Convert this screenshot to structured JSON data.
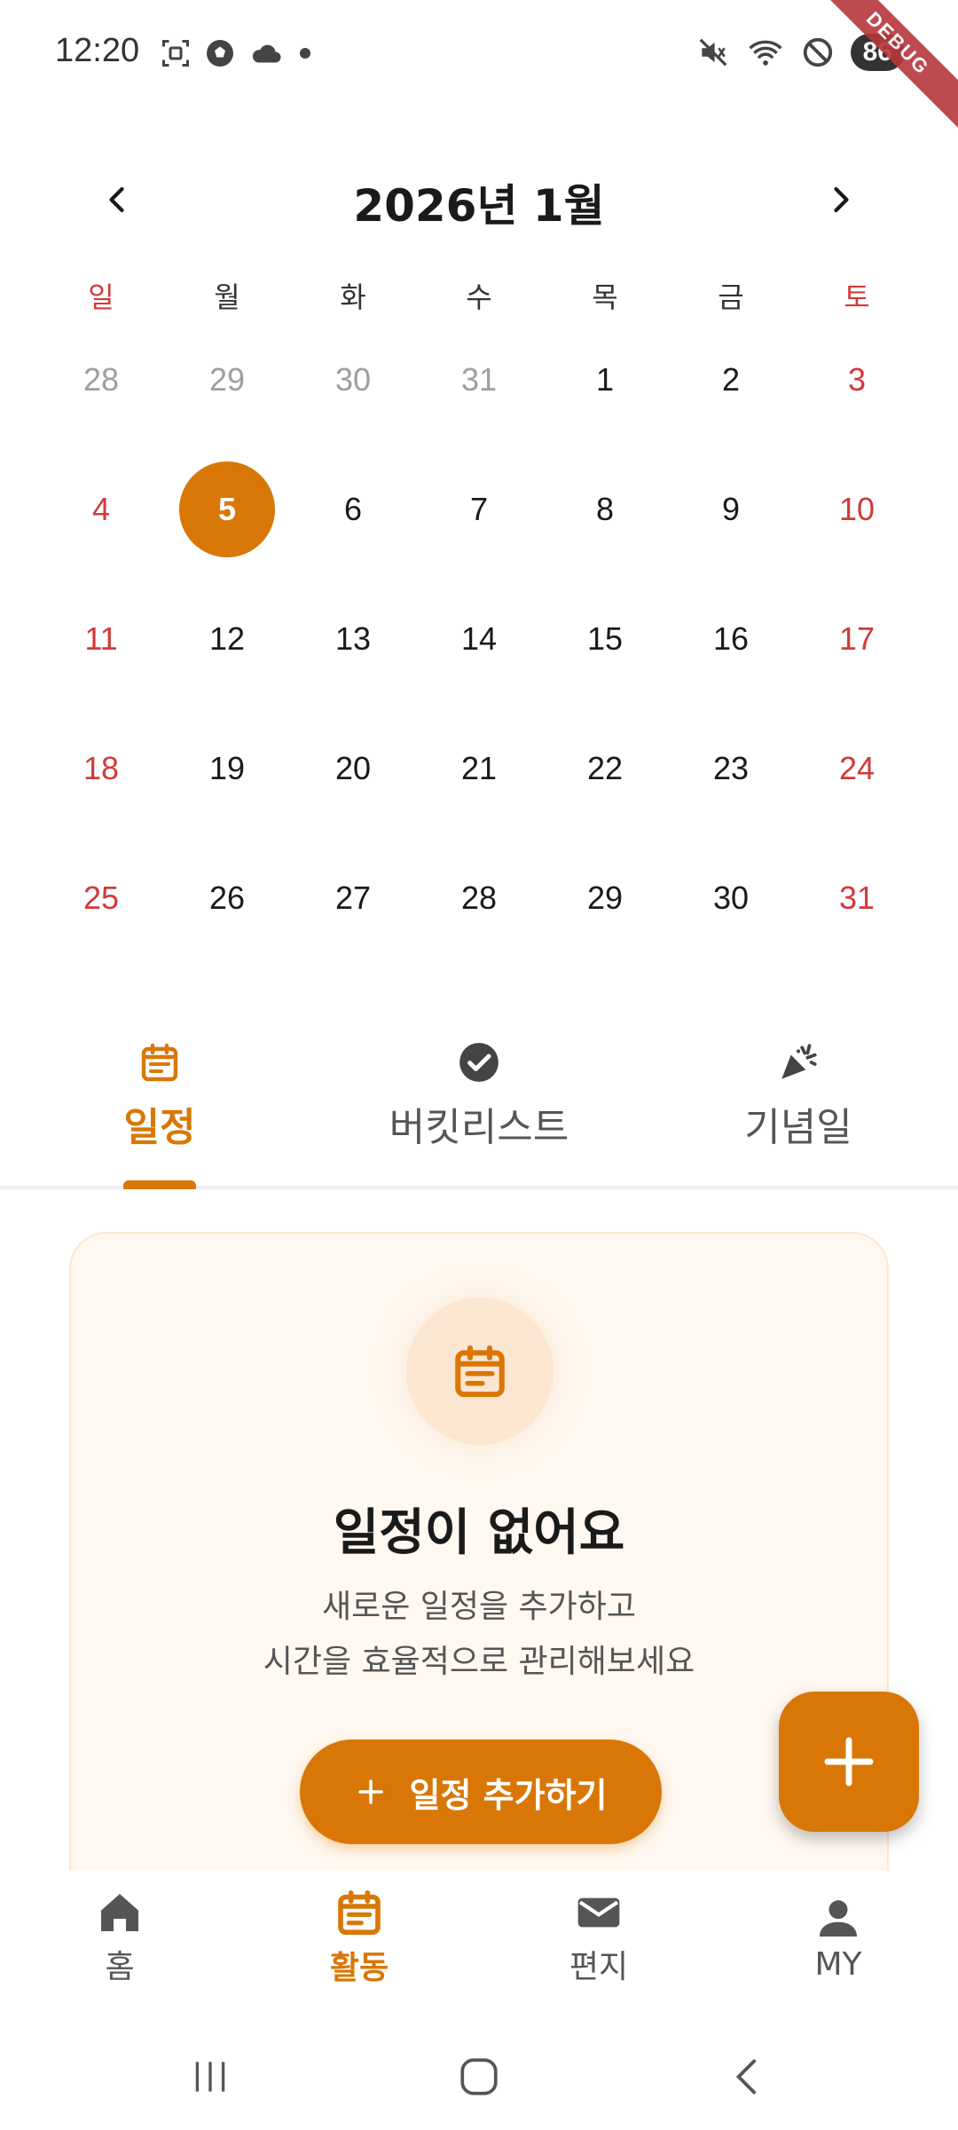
{
  "status_bar": {
    "time": "12:20",
    "battery": "86",
    "debug_label": "DEBUG",
    "left_icons": [
      "screenshot-icon",
      "soccer-ball-icon",
      "cloud-icon",
      "dot-icon"
    ],
    "right_icons": [
      "mute-icon",
      "wifi-icon",
      "do-not-disturb-icon"
    ]
  },
  "calendar": {
    "title": "2026년 1월",
    "weekdays": [
      "일",
      "월",
      "화",
      "수",
      "목",
      "금",
      "토"
    ],
    "selected_day": "5",
    "days": [
      {
        "d": "28",
        "other": true
      },
      {
        "d": "29",
        "other": true
      },
      {
        "d": "30",
        "other": true
      },
      {
        "d": "31",
        "other": true
      },
      {
        "d": "1"
      },
      {
        "d": "2"
      },
      {
        "d": "3",
        "weekend": true
      },
      {
        "d": "4",
        "weekend": true
      },
      {
        "d": "5",
        "selected": true
      },
      {
        "d": "6"
      },
      {
        "d": "7"
      },
      {
        "d": "8"
      },
      {
        "d": "9"
      },
      {
        "d": "10",
        "weekend": true
      },
      {
        "d": "11",
        "weekend": true
      },
      {
        "d": "12"
      },
      {
        "d": "13"
      },
      {
        "d": "14"
      },
      {
        "d": "15"
      },
      {
        "d": "16"
      },
      {
        "d": "17",
        "weekend": true
      },
      {
        "d": "18",
        "weekend": true
      },
      {
        "d": "19"
      },
      {
        "d": "20"
      },
      {
        "d": "21"
      },
      {
        "d": "22"
      },
      {
        "d": "23"
      },
      {
        "d": "24",
        "weekend": true
      },
      {
        "d": "25",
        "weekend": true
      },
      {
        "d": "26"
      },
      {
        "d": "27"
      },
      {
        "d": "28"
      },
      {
        "d": "29"
      },
      {
        "d": "30"
      },
      {
        "d": "31",
        "weekend": true
      }
    ]
  },
  "tabs": [
    {
      "label": "일정",
      "icon": "calendar-icon",
      "active": true
    },
    {
      "label": "버킷리스트",
      "icon": "check-circle-icon",
      "active": false
    },
    {
      "label": "기념일",
      "icon": "party-popper-icon",
      "active": false
    }
  ],
  "empty_state": {
    "title": "일정이 없어요",
    "desc_line1": "새로운 일정을 추가하고",
    "desc_line2": "시간을 효율적으로 관리해보세요",
    "button_label": "일정 추가하기"
  },
  "bottom_nav": [
    {
      "label": "홈",
      "icon": "home-icon",
      "active": false
    },
    {
      "label": "활동",
      "icon": "calendar-icon",
      "active": true
    },
    {
      "label": "편지",
      "icon": "mail-icon",
      "active": false
    },
    {
      "label": "MY",
      "icon": "person-icon",
      "active": false
    }
  ],
  "colors": {
    "accent": "#d97706",
    "weekend": "#d23a3a",
    "muted": "#9e9e9e"
  }
}
